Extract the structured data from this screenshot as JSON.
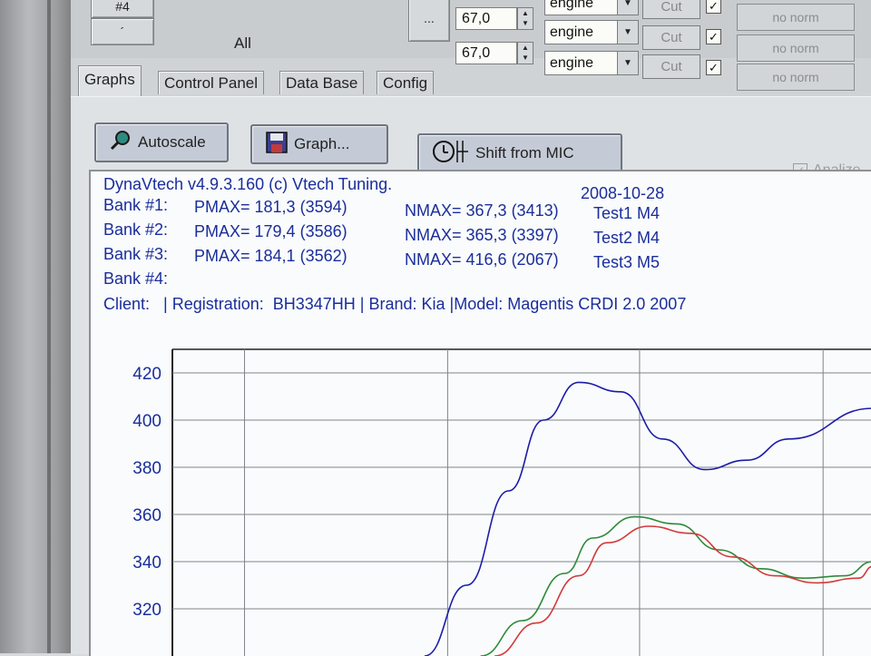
{
  "toolbar": {
    "hash_label": "#4",
    "small_label": "´",
    "all_label": "All",
    "ellipsis_label": "...",
    "rows": [
      {
        "value": "",
        "mode": "engine",
        "cut": "Cut",
        "checked": "✓",
        "norm": "no norm"
      },
      {
        "value": "67,0",
        "mode": "engine",
        "cut": "Cut",
        "checked": "✓",
        "norm": "no norm"
      },
      {
        "value": "67,0",
        "mode": "engine",
        "cut": "Cut",
        "checked": "✓",
        "norm": "no norm"
      }
    ]
  },
  "tabs": [
    {
      "label": "Graphs",
      "active": true
    },
    {
      "label": "Control Panel",
      "active": false
    },
    {
      "label": "Data Base",
      "active": false
    },
    {
      "label": "Config",
      "active": false
    }
  ],
  "buttons": {
    "autoscale": "Autoscale",
    "graph": "Graph...",
    "shift": "Shift from MIC",
    "analize": "Analize",
    "analize_checked": "✓"
  },
  "report": {
    "title": "DynaVtech v4.9.3.160 (c) Vtech Tuning.",
    "date": "2008-10-28",
    "banks": [
      {
        "label": "Bank #1:",
        "pmax": "PMAX= 181,3 (3594)",
        "nmax": "NMAX= 367,3 (3413)",
        "test": "Test1 M4"
      },
      {
        "label": "Bank #2:",
        "pmax": "PMAX= 179,4 (3586)",
        "nmax": "NMAX= 365,3 (3397)",
        "test": "Test2 M4"
      },
      {
        "label": "Bank #3:",
        "pmax": "PMAX= 184,1 (3562)",
        "nmax": "NMAX= 416,6 (2067)",
        "test": "Test3 M5"
      },
      {
        "label": "Bank #4:",
        "pmax": "",
        "nmax": "",
        "test": ""
      }
    ],
    "client_line": "Client:   | Registration:  BH3347HH | Brand: Kia |Model: Magentis CRDI 2.0 2007"
  },
  "colors": {
    "report_text": "#1a2e9b",
    "series_blue": "#1c1ca8",
    "series_green": "#2e8a3a",
    "series_red": "#d23a3a",
    "grid": "#7f8488"
  },
  "chart_data": {
    "type": "line",
    "y_ticks": [
      320,
      340,
      360,
      380,
      400,
      420
    ],
    "ylim": [
      300,
      430
    ],
    "xlim": [
      0,
      10
    ],
    "series": [
      {
        "color": "#1c1ca8",
        "x": [
          3.6,
          4.2,
          4.8,
          5.3,
          5.8,
          6.4,
          7.0,
          7.6,
          8.2,
          8.8,
          10.0
        ],
        "y": [
          300,
          330,
          370,
          400,
          416,
          412,
          392,
          379,
          383,
          392,
          405
        ]
      },
      {
        "color": "#2e8a3a",
        "x": [
          4.4,
          5.0,
          5.6,
          6.0,
          6.6,
          7.2,
          7.8,
          8.4,
          9.0,
          9.6,
          10.0
        ],
        "y": [
          300,
          315,
          335,
          350,
          359,
          356,
          345,
          337,
          333,
          334,
          340
        ]
      },
      {
        "color": "#d23a3a",
        "x": [
          4.6,
          5.2,
          5.8,
          6.2,
          6.8,
          7.4,
          8.0,
          8.6,
          9.2,
          9.8,
          10.0
        ],
        "y": [
          300,
          314,
          334,
          348,
          355,
          352,
          342,
          334,
          331,
          333,
          338
        ]
      }
    ]
  }
}
